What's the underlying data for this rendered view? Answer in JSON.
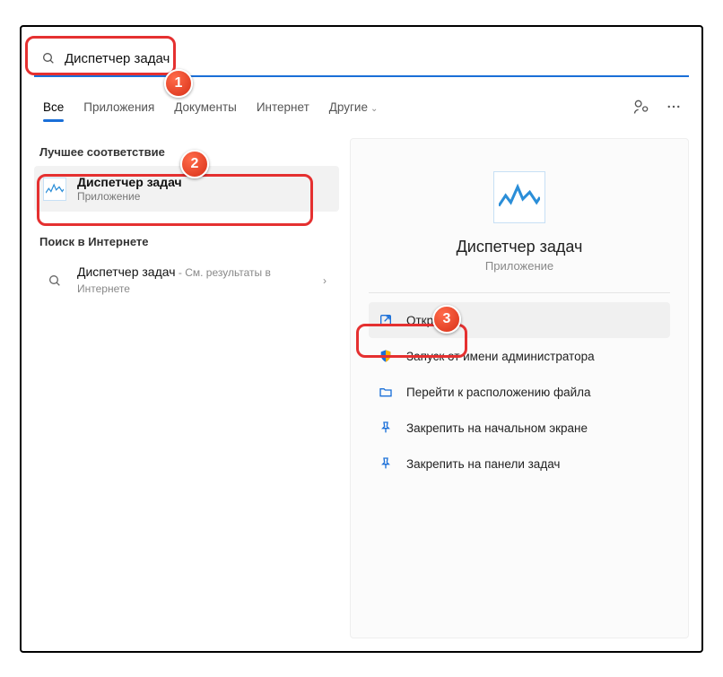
{
  "search": {
    "value": "Диспетчер задач"
  },
  "tabs": {
    "all": "Все",
    "apps": "Приложения",
    "docs": "Документы",
    "web": "Интернет",
    "other": "Другие"
  },
  "left": {
    "best_match_heading": "Лучшее соответствие",
    "best_match": {
      "title": "Диспетчер задач",
      "subtitle": "Приложение"
    },
    "web_heading": "Поиск в Интернете",
    "web_result": {
      "title": "Диспетчер задач",
      "subtitle": " - См. результаты в Интернете"
    }
  },
  "detail": {
    "title": "Диспетчер задач",
    "subtitle": "Приложение",
    "actions": {
      "open": "Открыть",
      "run_admin": "Запуск от имени администратора",
      "open_location": "Перейти к расположению файла",
      "pin_start": "Закрепить на начальном экране",
      "pin_taskbar": "Закрепить на панели задач"
    }
  },
  "callouts": {
    "c1": "1",
    "c2": "2",
    "c3": "3"
  }
}
